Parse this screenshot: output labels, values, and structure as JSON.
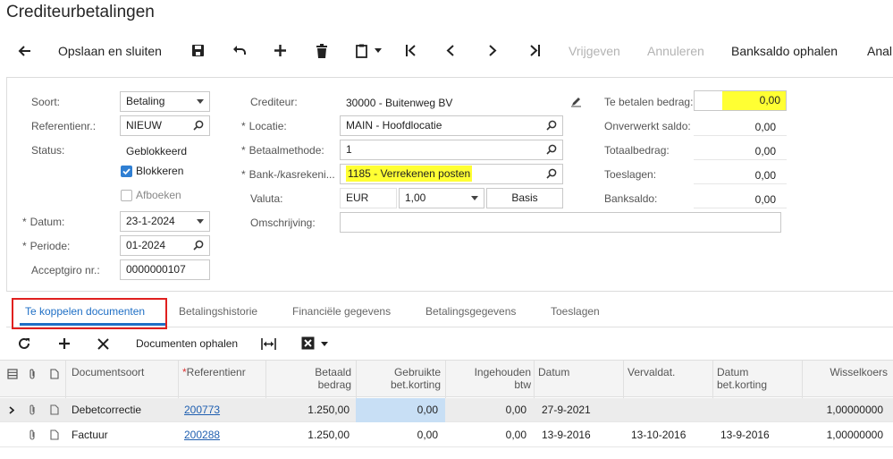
{
  "page": {
    "title": "Crediteurbetalingen"
  },
  "toolbar": {
    "save_close": "Opslaan en sluiten",
    "release": "Vrijgeven",
    "cancel": "Annuleren",
    "bank_balance": "Banksaldo ophalen",
    "analyze": "Anal"
  },
  "form": {
    "type_label": "Soort:",
    "type_value": "Betaling",
    "ref_label": "Referentienr.:",
    "ref_value": "NIEUW",
    "status_label": "Status:",
    "status_value": "Geblokkeerd",
    "block_label": "Blokkeren",
    "writeoff_label": "Afboeken",
    "date_label": "Datum:",
    "date_value": "23-1-2024",
    "period_label": "Periode:",
    "period_value": "01-2024",
    "acceptgiro_label": "Acceptgiro nr.:",
    "acceptgiro_value": "0000000107",
    "vendor_label": "Crediteur:",
    "vendor_value": "30000 - Buitenweg BV",
    "location_label": "Locatie:",
    "location_value": "MAIN - Hoofdlocatie",
    "paymethod_label": "Betaalmethode:",
    "paymethod_value": "1",
    "cashaccount_label": "Bank-/kasrekeni...",
    "cashaccount_value": "1185 - Verrekenen posten",
    "currency_label": "Valuta:",
    "currency_value": "EUR",
    "rate_value": "1,00",
    "basis_label": "Basis",
    "description_label": "Omschrijving:",
    "description_value": "",
    "amount_label": "Te betalen bedrag:",
    "amount_value": "0,00",
    "unapplied_label": "Onverwerkt saldo:",
    "unapplied_value": "0,00",
    "total_label": "Totaalbedrag:",
    "total_value": "0,00",
    "charges_label": "Toeslagen:",
    "charges_value": "0,00",
    "bankbalance_label": "Banksaldo:",
    "bankbalance_value": "0,00"
  },
  "tabs": [
    {
      "label": "Te koppelen documenten"
    },
    {
      "label": "Betalingshistorie"
    },
    {
      "label": "Financiële gegevens"
    },
    {
      "label": "Betalingsgegevens"
    },
    {
      "label": "Toeslagen"
    }
  ],
  "grid_toolbar": {
    "load_docs": "Documenten ophalen"
  },
  "grid": {
    "columns": {
      "doc_type": "Documentsoort",
      "ref_no": "Referentienr",
      "paid_amount_1": "Betaald",
      "paid_amount_2": "bedrag",
      "disc_used_1": "Gebruikte",
      "disc_used_2": "bet.korting",
      "vat_withheld_1": "Ingehouden",
      "vat_withheld_2": "btw",
      "date": "Datum",
      "due_date": "Vervaldat.",
      "disc_date_1": "Datum",
      "disc_date_2": "bet.korting",
      "exch_rate": "Wisselkoers"
    },
    "rows": [
      {
        "doc_type": "Debetcorrectie",
        "ref_no": "200773",
        "paid": "1.250,00",
        "disc": "0,00",
        "vat": "0,00",
        "date": "27-9-2021",
        "due": "",
        "disc_date": "",
        "rate": "1,00000000"
      },
      {
        "doc_type": "Factuur",
        "ref_no": "200288",
        "paid": "1.250,00",
        "disc": "0,00",
        "vat": "0,00",
        "date": "13-9-2016",
        "due": "13-10-2016",
        "disc_date": "13-9-2016",
        "rate": "1,00000000"
      }
    ]
  }
}
